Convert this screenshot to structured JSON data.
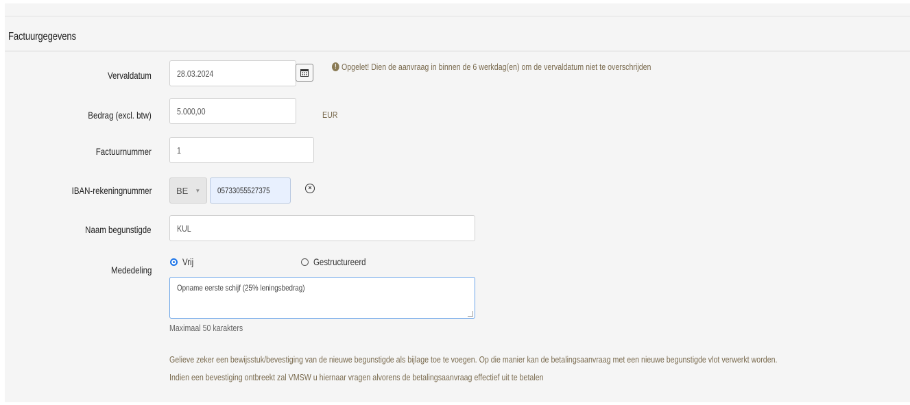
{
  "section": {
    "title": "Factuurgegevens"
  },
  "fields": {
    "vervaldatum": {
      "label": "Vervaldatum",
      "value": "28.03.2024"
    },
    "warning": "Opgelet! Dien de aanvraag in binnen de 6 werkdag(en) om de vervaldatum niet te overschrijden",
    "bedrag": {
      "label": "Bedrag (excl. btw)",
      "value": "5.000,00",
      "unit": "EUR"
    },
    "factuurnummer": {
      "label": "Factuurnummer",
      "value": "1"
    },
    "iban": {
      "label": "IBAN-rekeningnummer",
      "country": "BE",
      "value": "05733055527375"
    },
    "naam": {
      "label": "Naam begunstigde",
      "value": "KUL"
    },
    "mededeling": {
      "label": "Mededeling",
      "options": [
        "Vrij",
        "Gestructureerd"
      ],
      "selected": "Vrij",
      "value": "Opname eerste schijf (25% leningsbedrag)",
      "hint": "Maximaal 50 karakters"
    }
  },
  "note": {
    "line1": "Gelieve zeker een bewijsstuk/bevestiging van de nieuwe begunstigde als bijlage toe te voegen. Op die manier kan de betalingsaanvraag met een nieuwe begunstigde vlot verwerkt worden.",
    "line2": "Indien een bevestiging ontbreekt zal VMSW u hiernaar vragen alvorens de betalingsaanvraag effectief uit te betalen"
  },
  "icons": {
    "calendar": "calendar-icon",
    "warning": "exclamation-circle-icon",
    "clear": "close-circle-icon",
    "dropdown": "caret-down-icon"
  },
  "colors": {
    "accent": "#1a73e8",
    "warning_text": "#7a6b4f",
    "panel_bg": "#f5f5f5"
  }
}
